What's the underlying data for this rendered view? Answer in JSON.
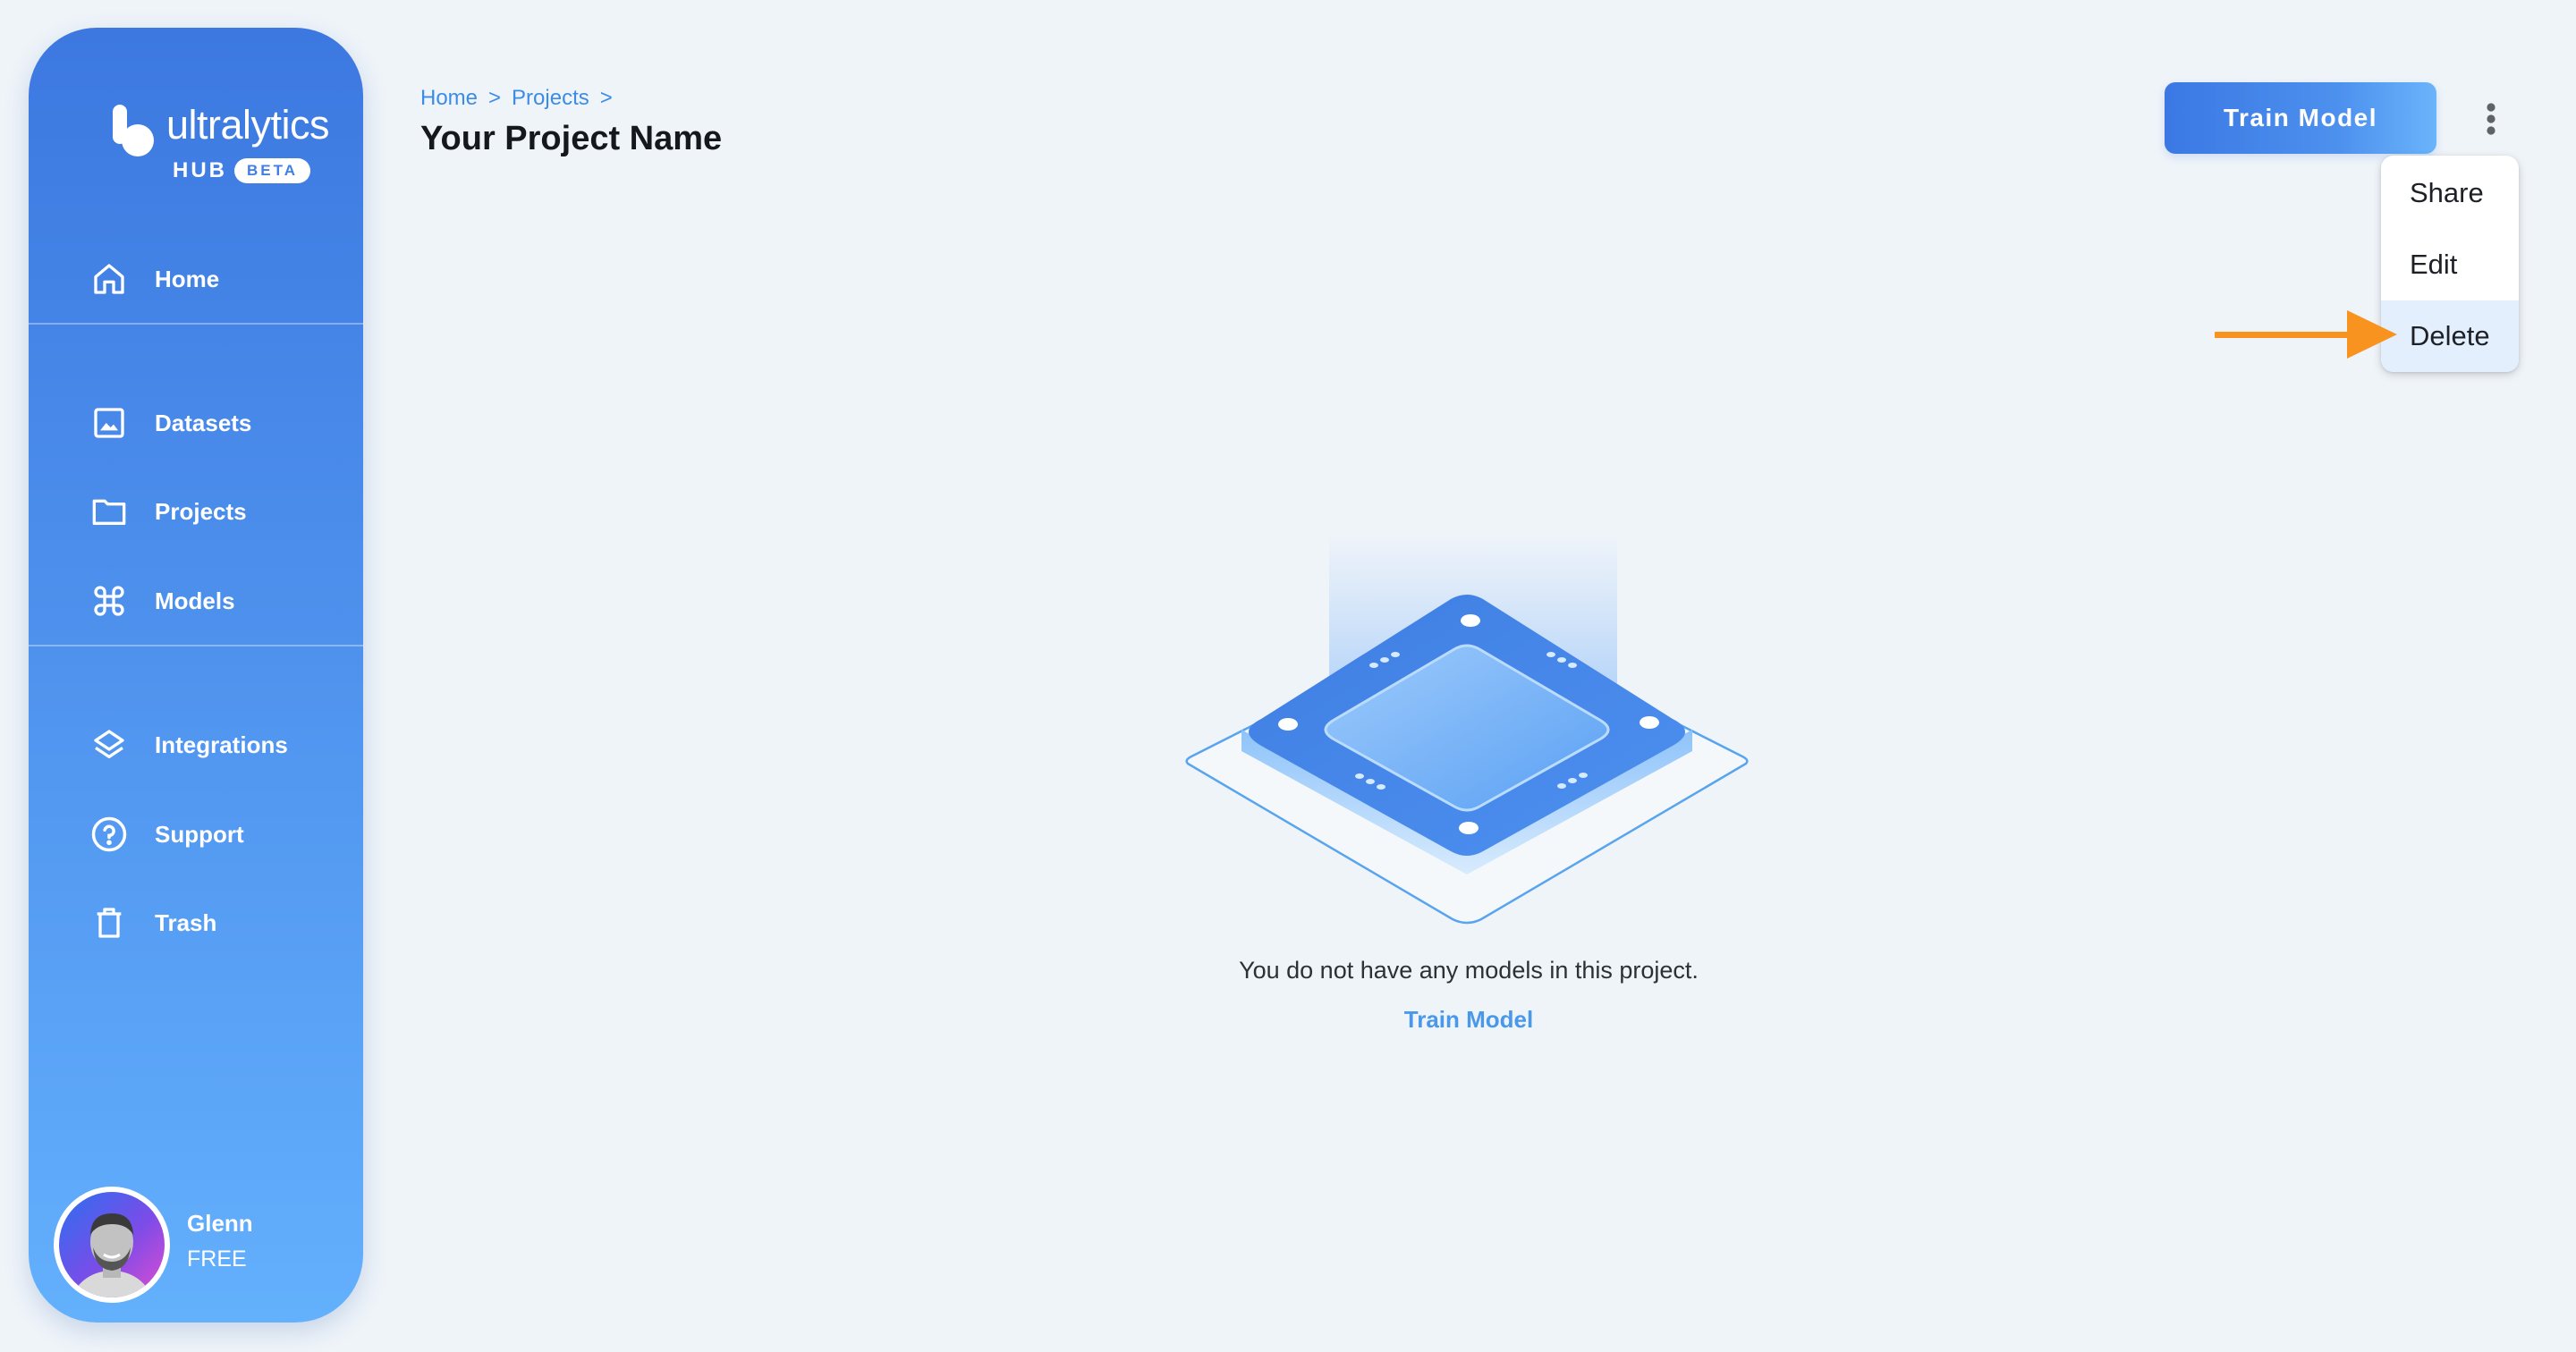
{
  "brand": {
    "name": "ultralytics",
    "product": "HUB",
    "badge": "BETA"
  },
  "sidebar": {
    "items": [
      {
        "label": "Home",
        "icon": "home-icon"
      },
      {
        "label": "Datasets",
        "icon": "image-icon"
      },
      {
        "label": "Projects",
        "icon": "folder-icon"
      },
      {
        "label": "Models",
        "icon": "command-icon"
      },
      {
        "label": "Integrations",
        "icon": "layers-icon"
      },
      {
        "label": "Support",
        "icon": "help-circle-icon"
      },
      {
        "label": "Trash",
        "icon": "trash-icon"
      }
    ]
  },
  "user": {
    "name": "Glenn",
    "plan": "FREE"
  },
  "header": {
    "breadcrumb": [
      {
        "label": "Home"
      },
      {
        "label": "Projects"
      }
    ],
    "separator": ">",
    "title": "Your Project Name",
    "train_button": "Train Model",
    "more_icon": "more-vertical-icon"
  },
  "menu": {
    "items": [
      {
        "label": "Share"
      },
      {
        "label": "Edit"
      },
      {
        "label": "Delete"
      }
    ],
    "highlighted": "Delete"
  },
  "empty_state": {
    "message": "You do not have any models in this project.",
    "link": "Train Model"
  },
  "colors": {
    "background": "#eff4f9",
    "sidebar_top": "#3c78e0",
    "sidebar_bottom": "#63b0fd",
    "accent": "#3c8ce6",
    "menu_highlight": "#e3effc",
    "annotation_arrow": "#f7931e"
  }
}
